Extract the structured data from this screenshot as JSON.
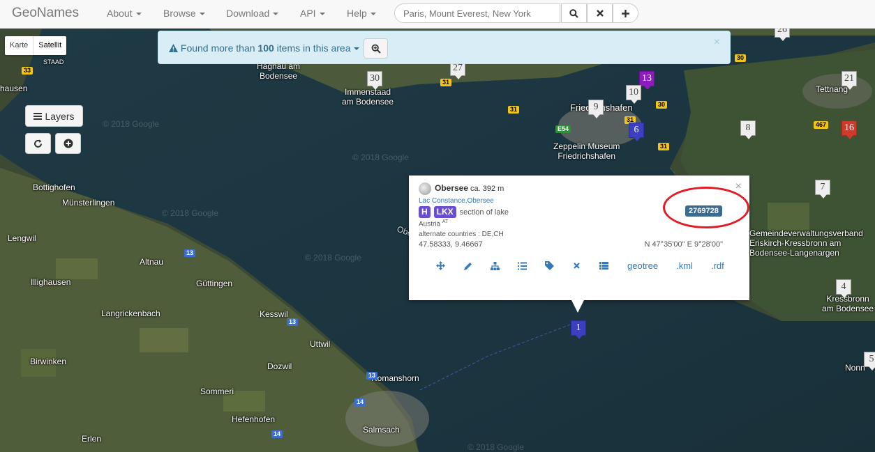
{
  "navbar": {
    "brand": "GeoNames",
    "menu": [
      {
        "label": "About"
      },
      {
        "label": "Browse"
      },
      {
        "label": "Download"
      },
      {
        "label": "API"
      },
      {
        "label": "Help"
      }
    ],
    "search_placeholder": "Paris, Mount Everest, New York",
    "buttons": [
      "search-icon",
      "close-icon",
      "plus-icon"
    ]
  },
  "map_controls": {
    "map_types": [
      "Karte",
      "Satellit"
    ],
    "active_type": "Satellit",
    "layers_label": "Layers",
    "refresh_icon": "refresh-icon",
    "add_icon": "plus-circle-icon"
  },
  "alert": {
    "prefix": "Found more than",
    "count": "100",
    "suffix": "items in this area",
    "close": "×"
  },
  "popup": {
    "name": "Obersee",
    "elevation": "ca. 392 m",
    "alternate_names_link": "Lac Constance,Obersee",
    "feature_class": "H",
    "feature_code": "LKX",
    "feature_description": "section of lake",
    "country": "Austria",
    "country_code": "AT",
    "alternate_countries": "alternate countries : DE,CH",
    "coords": "47.58333, 9.46667",
    "dms": "N 47°35'00\" E 9°28'00\"",
    "geoname_id": "2769728",
    "links": [
      "geotree",
      ".kml",
      ".rdf"
    ],
    "close": "×"
  },
  "markers": [
    {
      "label": "26",
      "color": "grey"
    },
    {
      "label": "27",
      "color": "grey"
    },
    {
      "label": "30",
      "color": "grey"
    },
    {
      "label": "13",
      "color": "purple"
    },
    {
      "label": "10",
      "color": "grey"
    },
    {
      "label": "21",
      "color": "grey"
    },
    {
      "label": "9",
      "color": "grey"
    },
    {
      "label": "6",
      "color": "blue"
    },
    {
      "label": "8",
      "color": "grey"
    },
    {
      "label": "16",
      "color": "red"
    },
    {
      "label": "7",
      "color": "grey"
    },
    {
      "label": "4",
      "color": "grey"
    },
    {
      "label": "5",
      "color": "grey"
    },
    {
      "label": "1",
      "color": "blue"
    }
  ],
  "place_labels": [
    "Hagnau am\nBodensee",
    "Immenstaad\nam Bodensee",
    "Friedrichshafen",
    "Zeppelin Museum\nFriedrichshafen",
    "Tettnang",
    "STAAD",
    "hausen",
    "Bottighofen",
    "Münsterlingen",
    "Lengwil",
    "Altnau",
    "Güttingen",
    "Illighausen",
    "Langrickenbach",
    "Kesswil",
    "Uttwil",
    "Birwinken",
    "Dozwil",
    "Sommeri",
    "Romanshorn",
    "Hefenhofen",
    "Salmsach",
    "Erlen",
    "Oberseeeinde",
    "Gemeindeverwaltungsverband\nEriskirch-Kressbronn am\nBodensee-Langenargen",
    "Kressbronn\nam Bodensee",
    "Nonn",
    "Obersee"
  ],
  "road_labels": [
    "33",
    "31",
    "31",
    "30",
    "30",
    "467",
    "31",
    "E54",
    "31",
    "13",
    "13",
    "13",
    "14",
    "14"
  ],
  "watermark": "© 2018 Google",
  "colors": {
    "navbar_bg": "#f8f8f8",
    "alert_bg": "#d9edf7",
    "alert_text": "#31708f",
    "badge_purple": "#6a4fd0",
    "id_badge": "#3d6a8f",
    "highlight": "#e21b24"
  }
}
